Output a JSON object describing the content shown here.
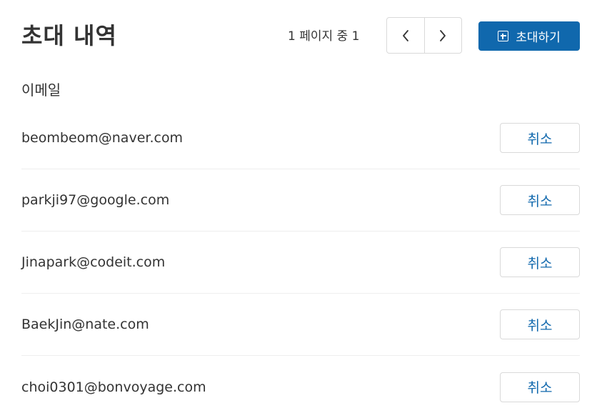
{
  "header": {
    "title": "초대 내역",
    "page_info": "1 페이지 중 1",
    "prev_icon": "chevron-left-icon",
    "next_icon": "chevron-right-icon",
    "invite_label": "초대하기",
    "invite_icon": "plus-square-icon",
    "accent_color": "#1068ad"
  },
  "table": {
    "column_email": "이메일",
    "cancel_label": "취소",
    "rows": [
      {
        "email": "beombeom@naver.com"
      },
      {
        "email": "parkji97@google.com"
      },
      {
        "email": "Jinapark@codeit.com"
      },
      {
        "email": "BaekJin@nate.com"
      },
      {
        "email": "choi0301@bonvoyage.com"
      }
    ]
  }
}
